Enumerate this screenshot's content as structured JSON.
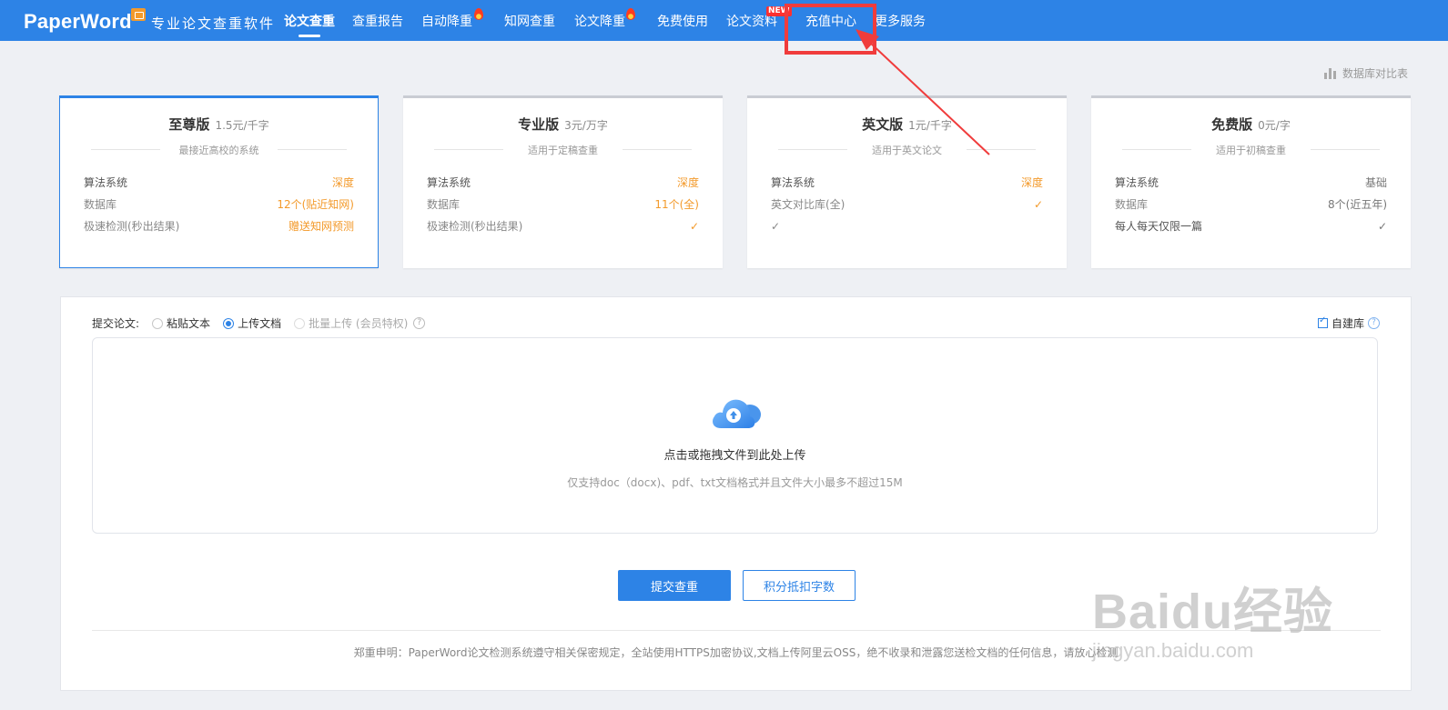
{
  "brand": {
    "name": "PaperWord",
    "slogan": "专业论文查重软件"
  },
  "nav": {
    "items": [
      {
        "label": "论文查重",
        "active": true
      },
      {
        "label": "查重报告"
      },
      {
        "label": "自动降重",
        "hot": true
      },
      {
        "label": "知网查重"
      },
      {
        "label": "论文降重",
        "hot": true
      },
      {
        "label": "免费使用"
      },
      {
        "label": "论文资料",
        "badge": "NEW"
      },
      {
        "label": "充值中心",
        "highlighted": true
      },
      {
        "label": "更多服务"
      }
    ]
  },
  "db_compare_label": "数据库对比表",
  "plans": [
    {
      "name": "至尊版",
      "price": "1.5元/千字",
      "subtitle": "最接近高校的系统",
      "rows": [
        {
          "label": "算法系统",
          "value": "深度"
        },
        {
          "label": "数据库",
          "value": "12个(贴近知网)"
        },
        {
          "label": "极速检测(秒出结果)",
          "value": "赠送知网预测"
        }
      ]
    },
    {
      "name": "专业版",
      "price": "3元/万字",
      "subtitle": "适用于定稿查重",
      "rows": [
        {
          "label": "算法系统",
          "value": "深度"
        },
        {
          "label": "数据库",
          "value": "11个(全)"
        },
        {
          "label": "极速检测(秒出结果)",
          "value": "✓"
        }
      ]
    },
    {
      "name": "英文版",
      "price": "1元/千字",
      "subtitle": "适用于英文论文",
      "rows": [
        {
          "label": "算法系统",
          "value": "深度"
        },
        {
          "label": "英文对比库(全)",
          "value": "✓"
        },
        {
          "label": "✓",
          "value": ""
        }
      ]
    },
    {
      "name": "免费版",
      "price": "0元/字",
      "subtitle": "适用于初稿查重",
      "rows": [
        {
          "label": "算法系统",
          "value": "基础"
        },
        {
          "label": "数据库",
          "value": "8个(近五年)"
        },
        {
          "label": "每人每天仅限一篇",
          "value": "✓"
        }
      ]
    }
  ],
  "upload": {
    "submit_label": "提交论文:",
    "options": [
      "粘贴文本",
      "上传文档",
      "批量上传 (会员特权)"
    ],
    "selected_option": "上传文档",
    "self_build_label": "自建库",
    "self_build_checked": true,
    "dropzone_title": "点击或拖拽文件到此处上传",
    "dropzone_hint": "仅支持doc（docx)、pdf、txt文档格式并且文件大小最多不超过15M"
  },
  "buttons": {
    "submit": "提交查重",
    "points": "积分抵扣字数"
  },
  "statement": "郑重申明：PaperWord论文检测系统遵守相关保密规定，全站使用HTTPS加密协议,文档上传阿里云OSS，绝不收录和泄露您送检文档的任何信息，请放心检测",
  "watermark": {
    "main": "Baidu经验",
    "url": "jingyan.baidu.com"
  },
  "colors": {
    "accent": "#2d83e6",
    "highlight": "#f39a2b",
    "annotation": "#f03c3c"
  }
}
